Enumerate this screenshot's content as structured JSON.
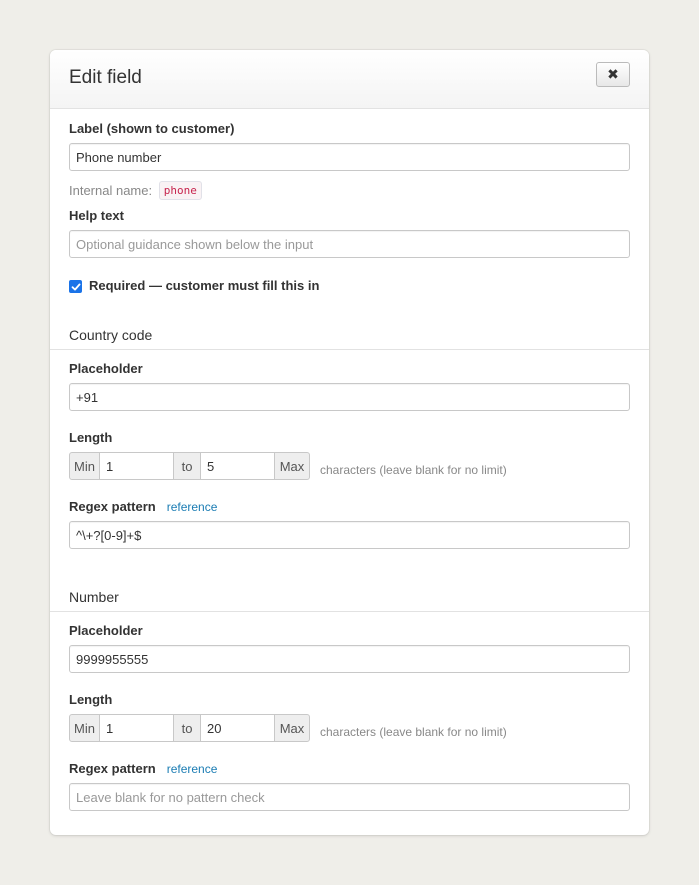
{
  "header": {
    "title": "Edit field",
    "close_label": "✖"
  },
  "label_field": {
    "label": "Label (shown to customer)",
    "value": "Phone number"
  },
  "internal_name": {
    "label": "Internal name:",
    "value": "phone"
  },
  "help_text": {
    "label": "Help text",
    "placeholder": "Optional guidance shown below the input"
  },
  "required": {
    "label": "Required — customer must fill this in",
    "checked": true
  },
  "country_code": {
    "title": "Country code",
    "placeholder_label": "Placeholder",
    "placeholder_value": "+91",
    "length_label": "Length",
    "min_label": "Min",
    "min_value": "1",
    "to_label": "to",
    "max_value": "5",
    "max_label": "Max",
    "length_hint": "characters (leave blank for no limit)",
    "regex_label": "Regex pattern",
    "regex_link": "reference",
    "regex_value": "^\\+?[0-9]+$"
  },
  "number": {
    "title": "Number",
    "placeholder_label": "Placeholder",
    "placeholder_value": "9999955555",
    "length_label": "Length",
    "min_label": "Min",
    "min_value": "1",
    "to_label": "to",
    "max_value": "20",
    "max_label": "Max",
    "length_hint": "characters (leave blank for no limit)",
    "regex_label": "Regex pattern",
    "regex_link": "reference",
    "regex_placeholder": "Leave blank for no pattern check"
  },
  "colors": {
    "accent": "#1a73e8",
    "link": "#1a7cb3",
    "badge_text": "#c7254e"
  }
}
